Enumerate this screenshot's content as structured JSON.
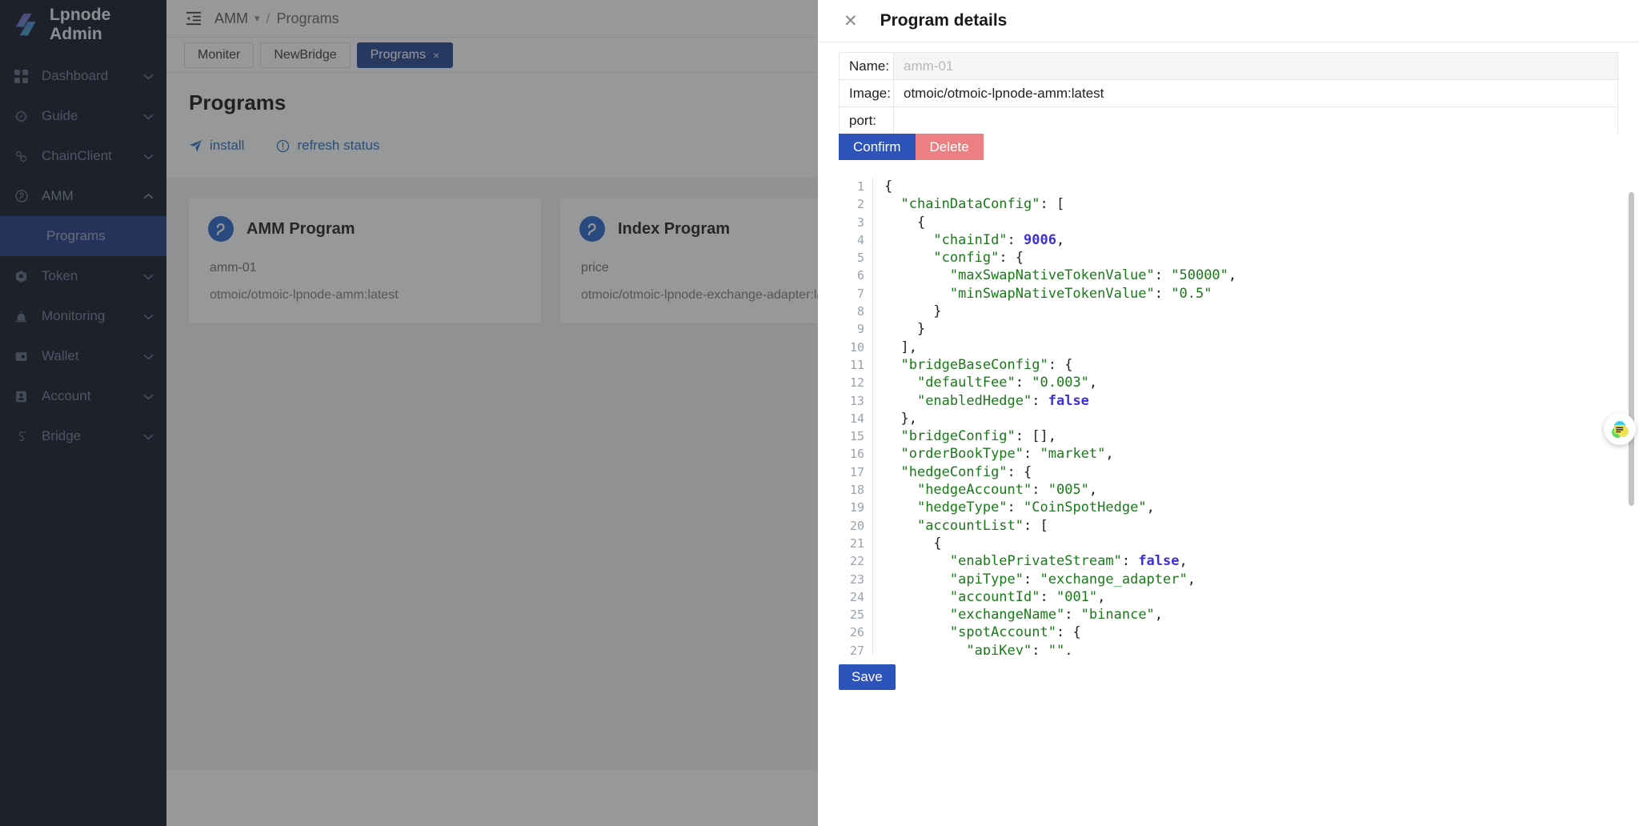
{
  "sidebar": {
    "brand": "Lpnode Admin",
    "items": [
      {
        "label": "Dashboard",
        "icon": "grid-icon",
        "expandable": true,
        "state": "collapsed"
      },
      {
        "label": "Guide",
        "icon": "compass-icon",
        "expandable": true,
        "state": "collapsed"
      },
      {
        "label": "ChainClient",
        "icon": "chain-icon",
        "expandable": true,
        "state": "collapsed"
      },
      {
        "label": "AMM",
        "icon": "amm-icon",
        "expandable": true,
        "state": "expanded"
      },
      {
        "label": "Token",
        "icon": "token-icon",
        "expandable": true,
        "state": "collapsed"
      },
      {
        "label": "Monitoring",
        "icon": "monitoring-icon",
        "expandable": true,
        "state": "collapsed"
      },
      {
        "label": "Wallet",
        "icon": "wallet-icon",
        "expandable": true,
        "state": "collapsed"
      },
      {
        "label": "Account",
        "icon": "account-icon",
        "expandable": true,
        "state": "collapsed"
      },
      {
        "label": "Bridge",
        "icon": "bridge-icon",
        "expandable": true,
        "state": "collapsed"
      }
    ],
    "submenu": {
      "label": "Programs",
      "active": true
    }
  },
  "topbar": {
    "collapse_icon": "menu-collapse-icon",
    "breadcrumb_root": "AMM",
    "breadcrumb_separator": "/",
    "breadcrumb_current": "Programs"
  },
  "tabs": [
    {
      "label": "Moniter",
      "active": false,
      "closable": false
    },
    {
      "label": "NewBridge",
      "active": false,
      "closable": false
    },
    {
      "label": "Programs",
      "active": true,
      "closable": true,
      "close_glyph": "×"
    }
  ],
  "page": {
    "title": "Programs",
    "actions": [
      {
        "label": "install",
        "icon": "send-icon"
      },
      {
        "label": "refresh status",
        "icon": "exclamation-circle-icon"
      }
    ],
    "cards": [
      {
        "icon": "program-icon",
        "title": "AMM Program",
        "name": "amm-01",
        "image": "otmoic/otmoic-lpnode-amm:latest"
      },
      {
        "icon": "program-icon",
        "title": "Index Program",
        "name": "price",
        "image": "otmoic/otmoic-lpnode-exchange-adapter:latest"
      }
    ]
  },
  "drawer": {
    "title": "Program details",
    "close_glyph": "✕",
    "fields": [
      {
        "label": "Name:",
        "value": "",
        "placeholder": "amm-01",
        "disabled": true
      },
      {
        "label": "Image:",
        "value": "otmoic/otmoic-lpnode-amm:latest",
        "placeholder": "",
        "disabled": false
      },
      {
        "label": "port:",
        "value": "",
        "placeholder": "",
        "disabled": false
      }
    ],
    "buttons": {
      "confirm": "Confirm",
      "delete": "Delete",
      "save": "Save"
    },
    "fab_icon": "chat-note-icon",
    "colors": {
      "primary": "#2d54ba",
      "danger": "#ec7f82",
      "tab_active": "#22408c",
      "sidebar_bg": "#0b1121",
      "link": "#2b6cb8"
    },
    "editor": {
      "language": "json",
      "lines": [
        {
          "n": 1,
          "tokens": [
            {
              "t": "{",
              "c": "p"
            }
          ]
        },
        {
          "n": 2,
          "tokens": [
            {
              "t": "  ",
              "c": "p"
            },
            {
              "t": "\"chainDataConfig\"",
              "c": "k"
            },
            {
              "t": ": [",
              "c": "p"
            }
          ]
        },
        {
          "n": 3,
          "tokens": [
            {
              "t": "    {",
              "c": "p"
            }
          ]
        },
        {
          "n": 4,
          "tokens": [
            {
              "t": "      ",
              "c": "p"
            },
            {
              "t": "\"chainId\"",
              "c": "k"
            },
            {
              "t": ": ",
              "c": "p"
            },
            {
              "t": "9006",
              "c": "n"
            },
            {
              "t": ",",
              "c": "p"
            }
          ]
        },
        {
          "n": 5,
          "tokens": [
            {
              "t": "      ",
              "c": "p"
            },
            {
              "t": "\"config\"",
              "c": "k"
            },
            {
              "t": ": {",
              "c": "p"
            }
          ]
        },
        {
          "n": 6,
          "tokens": [
            {
              "t": "        ",
              "c": "p"
            },
            {
              "t": "\"maxSwapNativeTokenValue\"",
              "c": "k"
            },
            {
              "t": ": ",
              "c": "p"
            },
            {
              "t": "\"50000\"",
              "c": "k"
            },
            {
              "t": ",",
              "c": "p"
            }
          ]
        },
        {
          "n": 7,
          "tokens": [
            {
              "t": "        ",
              "c": "p"
            },
            {
              "t": "\"minSwapNativeTokenValue\"",
              "c": "k"
            },
            {
              "t": ": ",
              "c": "p"
            },
            {
              "t": "\"0.5\"",
              "c": "k"
            }
          ]
        },
        {
          "n": 8,
          "tokens": [
            {
              "t": "      }",
              "c": "p"
            }
          ]
        },
        {
          "n": 9,
          "tokens": [
            {
              "t": "    }",
              "c": "p"
            }
          ]
        },
        {
          "n": 10,
          "tokens": [
            {
              "t": "  ],",
              "c": "p"
            }
          ]
        },
        {
          "n": 11,
          "tokens": [
            {
              "t": "  ",
              "c": "p"
            },
            {
              "t": "\"bridgeBaseConfig\"",
              "c": "k"
            },
            {
              "t": ": {",
              "c": "p"
            }
          ]
        },
        {
          "n": 12,
          "tokens": [
            {
              "t": "    ",
              "c": "p"
            },
            {
              "t": "\"defaultFee\"",
              "c": "k"
            },
            {
              "t": ": ",
              "c": "p"
            },
            {
              "t": "\"0.003\"",
              "c": "k"
            },
            {
              "t": ",",
              "c": "p"
            }
          ]
        },
        {
          "n": 13,
          "tokens": [
            {
              "t": "    ",
              "c": "p"
            },
            {
              "t": "\"enabledHedge\"",
              "c": "k"
            },
            {
              "t": ": ",
              "c": "p"
            },
            {
              "t": "false",
              "c": "n"
            }
          ]
        },
        {
          "n": 14,
          "tokens": [
            {
              "t": "  },",
              "c": "p"
            }
          ]
        },
        {
          "n": 15,
          "tokens": [
            {
              "t": "  ",
              "c": "p"
            },
            {
              "t": "\"bridgeConfig\"",
              "c": "k"
            },
            {
              "t": ": [],",
              "c": "p"
            }
          ]
        },
        {
          "n": 16,
          "tokens": [
            {
              "t": "  ",
              "c": "p"
            },
            {
              "t": "\"orderBookType\"",
              "c": "k"
            },
            {
              "t": ": ",
              "c": "p"
            },
            {
              "t": "\"market\"",
              "c": "k"
            },
            {
              "t": ",",
              "c": "p"
            }
          ]
        },
        {
          "n": 17,
          "tokens": [
            {
              "t": "  ",
              "c": "p"
            },
            {
              "t": "\"hedgeConfig\"",
              "c": "k"
            },
            {
              "t": ": {",
              "c": "p"
            }
          ]
        },
        {
          "n": 18,
          "tokens": [
            {
              "t": "    ",
              "c": "p"
            },
            {
              "t": "\"hedgeAccount\"",
              "c": "k"
            },
            {
              "t": ": ",
              "c": "p"
            },
            {
              "t": "\"005\"",
              "c": "k"
            },
            {
              "t": ",",
              "c": "p"
            }
          ]
        },
        {
          "n": 19,
          "tokens": [
            {
              "t": "    ",
              "c": "p"
            },
            {
              "t": "\"hedgeType\"",
              "c": "k"
            },
            {
              "t": ": ",
              "c": "p"
            },
            {
              "t": "\"CoinSpotHedge\"",
              "c": "k"
            },
            {
              "t": ",",
              "c": "p"
            }
          ]
        },
        {
          "n": 20,
          "tokens": [
            {
              "t": "    ",
              "c": "p"
            },
            {
              "t": "\"accountList\"",
              "c": "k"
            },
            {
              "t": ": [",
              "c": "p"
            }
          ]
        },
        {
          "n": 21,
          "tokens": [
            {
              "t": "      {",
              "c": "p"
            }
          ]
        },
        {
          "n": 22,
          "tokens": [
            {
              "t": "        ",
              "c": "p"
            },
            {
              "t": "\"enablePrivateStream\"",
              "c": "k"
            },
            {
              "t": ": ",
              "c": "p"
            },
            {
              "t": "false",
              "c": "n"
            },
            {
              "t": ",",
              "c": "p"
            }
          ]
        },
        {
          "n": 23,
          "tokens": [
            {
              "t": "        ",
              "c": "p"
            },
            {
              "t": "\"apiType\"",
              "c": "k"
            },
            {
              "t": ": ",
              "c": "p"
            },
            {
              "t": "\"exchange_adapter\"",
              "c": "k"
            },
            {
              "t": ",",
              "c": "p"
            }
          ]
        },
        {
          "n": 24,
          "tokens": [
            {
              "t": "        ",
              "c": "p"
            },
            {
              "t": "\"accountId\"",
              "c": "k"
            },
            {
              "t": ": ",
              "c": "p"
            },
            {
              "t": "\"001\"",
              "c": "k"
            },
            {
              "t": ",",
              "c": "p"
            }
          ]
        },
        {
          "n": 25,
          "tokens": [
            {
              "t": "        ",
              "c": "p"
            },
            {
              "t": "\"exchangeName\"",
              "c": "k"
            },
            {
              "t": ": ",
              "c": "p"
            },
            {
              "t": "\"binance\"",
              "c": "k"
            },
            {
              "t": ",",
              "c": "p"
            }
          ]
        },
        {
          "n": 26,
          "tokens": [
            {
              "t": "        ",
              "c": "p"
            },
            {
              "t": "\"spotAccount\"",
              "c": "k"
            },
            {
              "t": ": {",
              "c": "p"
            }
          ]
        },
        {
          "n": 27,
          "tokens": [
            {
              "t": "          ",
              "c": "p"
            },
            {
              "t": "\"apiKey\"",
              "c": "k"
            },
            {
              "t": ": ",
              "c": "p"
            },
            {
              "t": "\"\"",
              "c": "k"
            },
            {
              "t": ",",
              "c": "p"
            }
          ]
        }
      ]
    }
  }
}
